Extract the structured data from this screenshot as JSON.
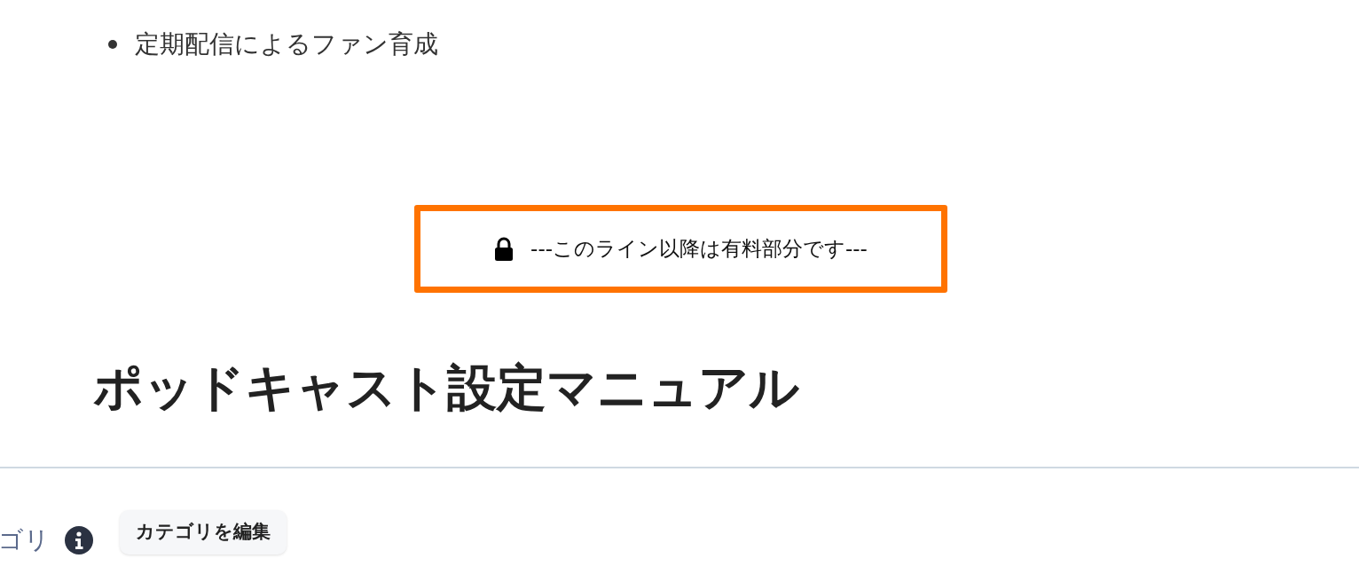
{
  "bullets": [
    "定期配信によるファン育成"
  ],
  "paywall": {
    "text": "---このライン以降は有料部分です---"
  },
  "heading": "ポッドキャスト設定マニュアル",
  "category": {
    "label": "ゴリ",
    "button": "カテゴリを編集"
  }
}
